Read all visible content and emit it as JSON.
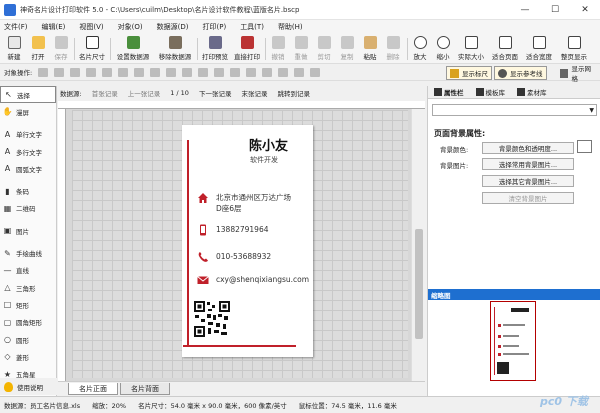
{
  "window": {
    "title": "神奇名片设计打印软件 5.0 - C:\\Users\\cuilm\\Desktop\\名片设计软件教程\\蓝版名片.bscp",
    "min": "—",
    "max": "☐",
    "close": "✕"
  },
  "menu": [
    "文件(F)",
    "编辑(E)",
    "视图(V)",
    "对象(O)",
    "数据源(D)",
    "打印(P)",
    "工具(T)",
    "帮助(H)"
  ],
  "toolbar": {
    "new": "新建",
    "open": "打开",
    "save": "保存",
    "card_size": "名片尺寸",
    "set_datasource": "设置数据源",
    "remove_datasource": "移除数据源",
    "print_preview": "打印预览",
    "print_direct": "直接打印",
    "undo": "撤销",
    "redo": "重做",
    "cut": "剪切",
    "copy": "复制",
    "paste": "粘贴",
    "delete": "删除",
    "zoom_in": "放大",
    "zoom_out": "缩小",
    "actual_size": "实际大小",
    "fit_page": "适合页面",
    "fit_width": "适合宽度",
    "full_page": "整页显示"
  },
  "objbar": {
    "label": "对象操作:",
    "show_ruler": "显示标尺",
    "show_ref": "显示参考线",
    "show_grid": "显示网格"
  },
  "tools": [
    {
      "label": "选择",
      "icon": "↖"
    },
    {
      "label": "漫屏",
      "icon": "✋"
    },
    {
      "label": "单行文字",
      "icon": "A"
    },
    {
      "label": "多行文字",
      "icon": "A"
    },
    {
      "label": "圆弧文字",
      "icon": "A"
    },
    {
      "label": "条码",
      "icon": "▮"
    },
    {
      "label": "二维码",
      "icon": "▦"
    },
    {
      "label": "图片",
      "icon": "▣"
    },
    {
      "label": "手绘曲线",
      "icon": "✎"
    },
    {
      "label": "直线",
      "icon": "—"
    },
    {
      "label": "三角形",
      "icon": "△"
    },
    {
      "label": "矩形",
      "icon": "□"
    },
    {
      "label": "圆角矩形",
      "icon": "▢"
    },
    {
      "label": "圆形",
      "icon": "○"
    },
    {
      "label": "菱形",
      "icon": "◇"
    },
    {
      "label": "五角星",
      "icon": "★"
    }
  ],
  "hint": "使用说明",
  "datasource_bar": {
    "label": "数据源:",
    "first": "首张记录",
    "prev": "上一张记录",
    "page": "1 / 10",
    "next": "下一张记录",
    "last": "末张记录",
    "jump": "跳转到记录"
  },
  "card": {
    "name": "陈小友",
    "title": "软件开发",
    "address": "北京市通州区万达广场\nD座6层",
    "phone": "13882791964",
    "tel": "010-53688932",
    "email": "cxy@shenqixiangsu.com",
    "accent": "#c0202a"
  },
  "tabs": {
    "front": "名片正面",
    "back": "名片背面"
  },
  "rightpanel": {
    "tab_props": "属性栏",
    "tab_templates": "模板库",
    "tab_assets": "素材库",
    "heading": "页面背景属性:",
    "bg_color_label": "背景颜色:",
    "bg_image_label": "背景图片:",
    "btn_bg_color": "背景颜色和透明度...",
    "btn_common_bg": "选择常用背景图片...",
    "btn_other_bg": "选择其它背景图片...",
    "btn_clear_bg": "清空背景图片",
    "thumbnail": "缩略图"
  },
  "status": {
    "datasource": "数据源：员工名片信息.xls",
    "zoom": "缩放：20%",
    "card_size": "名片尺寸：54.0 毫米 x 90.0 毫米，600 像素/英寸",
    "mouse": "鼠标位置：74.5 毫米，11.6 毫米"
  },
  "watermark": "pc0 下载"
}
